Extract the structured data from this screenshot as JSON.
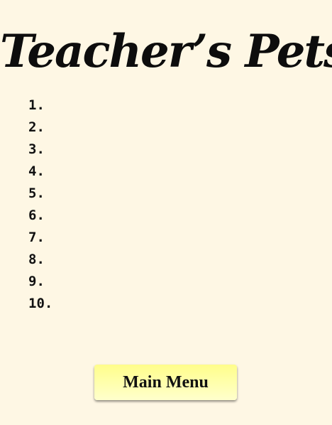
{
  "title": "Teacher’s Pets",
  "scores": [
    {
      "rank": "1.",
      "name": ""
    },
    {
      "rank": "2.",
      "name": ""
    },
    {
      "rank": "3.",
      "name": ""
    },
    {
      "rank": "4.",
      "name": ""
    },
    {
      "rank": "5.",
      "name": ""
    },
    {
      "rank": "6.",
      "name": ""
    },
    {
      "rank": "7.",
      "name": ""
    },
    {
      "rank": "8.",
      "name": ""
    },
    {
      "rank": "9.",
      "name": ""
    },
    {
      "rank": "10.",
      "name": ""
    }
  ],
  "main_menu_label": "Main Menu",
  "colors": {
    "background": "#fef7e4",
    "button": "#ffffa8",
    "text": "#111111"
  }
}
